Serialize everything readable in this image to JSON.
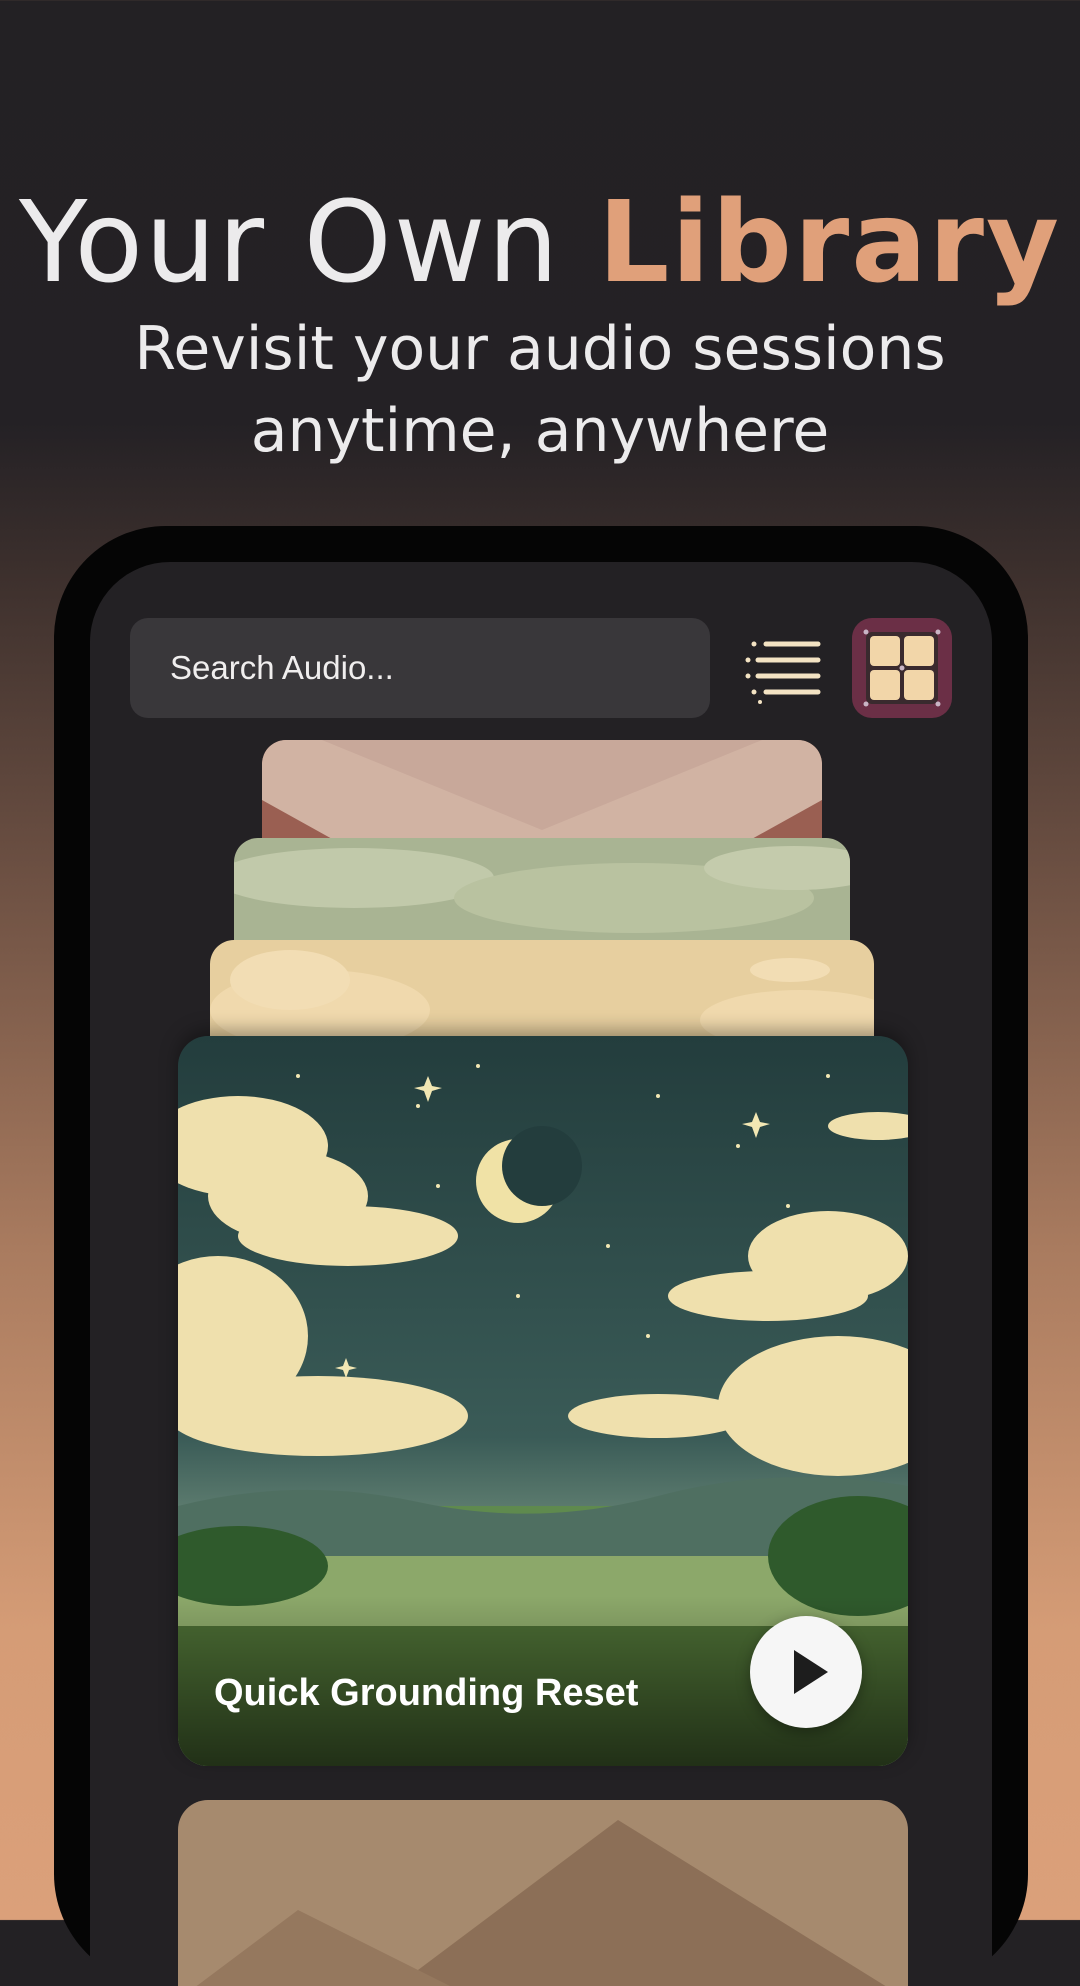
{
  "headline": {
    "part1": "Your Own ",
    "part2": "Library"
  },
  "subheadline": {
    "line1": "Revisit your audio sessions",
    "line2": "anytime, anywhere"
  },
  "app": {
    "search": {
      "placeholder": "Search Audio..."
    },
    "view_toggle": {
      "list_icon": "list-icon",
      "grid_icon": "grid-icon",
      "active": "grid"
    },
    "featured_card": {
      "title": "Quick Grounding Reset",
      "action_icon": "play-icon"
    }
  },
  "colors": {
    "accent": "#e0a07a",
    "grid_active_bg": "#6b2f46",
    "screen_bg": "#232124"
  }
}
